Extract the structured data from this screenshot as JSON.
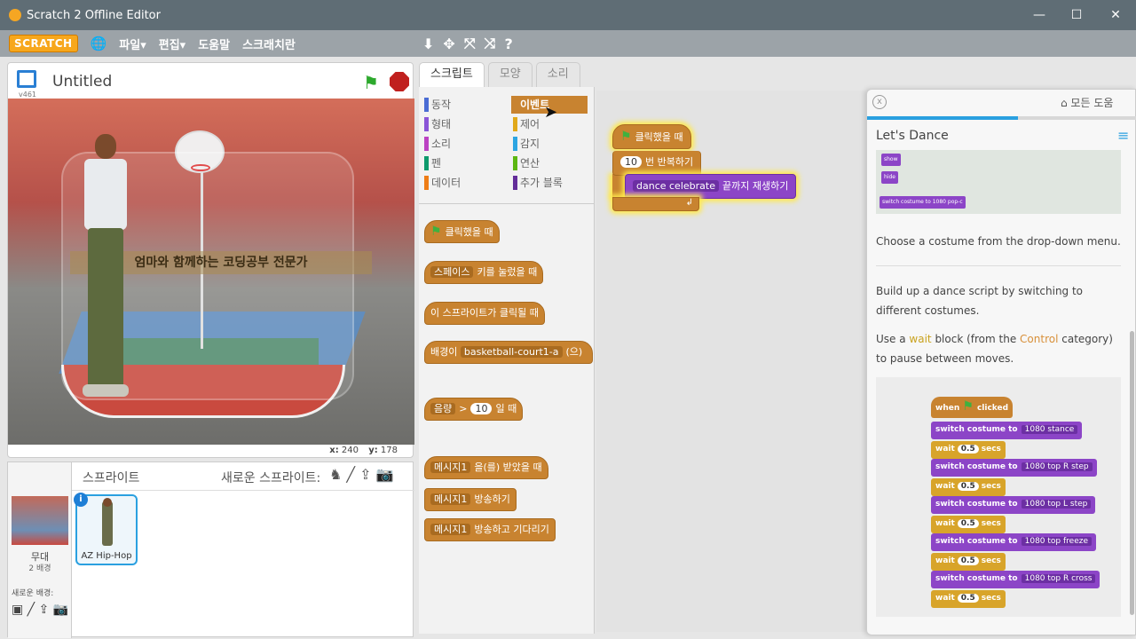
{
  "window": {
    "title": "Scratch 2 Offline Editor",
    "minimize": "—",
    "maximize": "☐",
    "close": "✕"
  },
  "menubar": {
    "logo": "SCRATCH",
    "globe": "🌐",
    "items": [
      "파일▾",
      "편집▾",
      "도움말",
      "스크래치란"
    ],
    "tools": [
      "⬇",
      "✥",
      "⤧",
      "⤨",
      "?"
    ]
  },
  "stage": {
    "title": "Untitled",
    "version": "v461",
    "overlay_text": "엄마와 함께하는 코딩공부 전문가",
    "x_label": "x:",
    "x_value": "240",
    "y_label": "y:",
    "y_value": "178"
  },
  "sprites": {
    "header": "스프라이트",
    "new_sprite": "새로운 스프라이트:",
    "new_sprite_icons": "♞ ╱ ⇪ 📷",
    "stage_label": "무대",
    "stage_count": "2 배경",
    "new_backdrop": "새로운 배경:",
    "new_backdrop_icons": "▣ ╱ ⇪ 📷",
    "items": [
      {
        "name": "AZ Hip-Hop",
        "info": "i"
      }
    ]
  },
  "tabs": [
    "스크립트",
    "모양",
    "소리"
  ],
  "categories": [
    {
      "label": "동작",
      "color": "#4a6cd4"
    },
    {
      "label": "이벤트",
      "color": "#c88330"
    },
    {
      "label": "형태",
      "color": "#8a55d7"
    },
    {
      "label": "제어",
      "color": "#e1a91a"
    },
    {
      "label": "소리",
      "color": "#bb42c3"
    },
    {
      "label": "감지",
      "color": "#2ca5e2"
    },
    {
      "label": "펜",
      "color": "#0e9a6c"
    },
    {
      "label": "연산",
      "color": "#5cb712"
    },
    {
      "label": "데이터",
      "color": "#ee7d16"
    },
    {
      "label": "추가 블록",
      "color": "#632d99"
    }
  ],
  "palette_blocks": {
    "when_flag": "클릭했을 때",
    "key_dd": "스페이스",
    "key_text": "키를 눌렀을 때",
    "sprite_clicked": "이 스프라이트가 클릭될 때",
    "backdrop_pre": "배경이",
    "backdrop_dd": "basketball-court1-a",
    "backdrop_post": "(으)",
    "loudness_dd": "음량",
    "loudness_op": ">",
    "loudness_num": "10",
    "loudness_post": "일 때",
    "msg_dd": "메시지1",
    "receive": "을(를) 받았을 때",
    "broadcast": "방송하기",
    "broadcast_wait": "방송하고 기다리기"
  },
  "script": {
    "hat": "클릭했을 때",
    "repeat_num": "10",
    "repeat_text": "번 반복하기",
    "sound_dd": "dance celebrate",
    "sound_text": "끝까지 재생하기",
    "loop_arrow": "↲"
  },
  "tips": {
    "close": "x",
    "home": "⌂ 모든 도움",
    "progress": 0.56,
    "title": "Let's Dance",
    "menu": "≡",
    "mini_show": "show",
    "mini_hide": "hide",
    "mini_switch": "switch costume to",
    "mini_switch_dd": "1080 pop-c",
    "p1": "Choose a costume from the drop-down menu.",
    "p2": "Build up a dance script by switching to different costumes.",
    "p3_a": "Use a ",
    "p3_wait": "wait",
    "p3_b": " block (from the ",
    "p3_control": "Control",
    "p3_c": " category) to pause between moves.",
    "example": {
      "when": "when",
      "clicked": "clicked",
      "switch": "switch costume to",
      "wait": "wait",
      "secs": "secs",
      "wait_num": "0.5",
      "costumes": [
        "1080 stance",
        "1080 top R step",
        "1080 top L step",
        "1080 top freeze",
        "1080 top R cross"
      ]
    }
  }
}
